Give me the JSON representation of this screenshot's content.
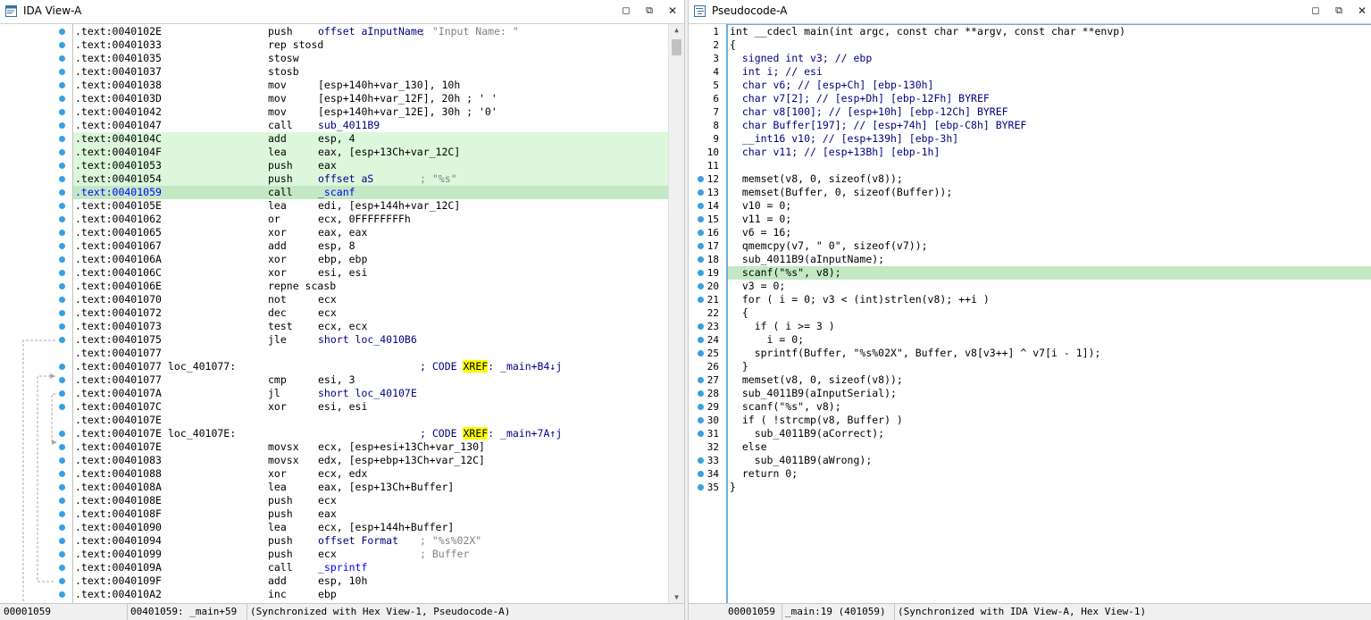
{
  "left": {
    "title": "IDA View-A",
    "status": {
      "offset": "00001059",
      "location": "00401059: _main+59",
      "sync": "(Synchronized with Hex View-1, Pseudocode-A)"
    },
    "lines": [
      {
        "addr": ".text:0040102E",
        "mn": "push",
        "op": "offset aInputName",
        "cm": "; \"Input Name: \""
      },
      {
        "addr": ".text:00401033",
        "mn": "rep stosd",
        "op": ""
      },
      {
        "addr": ".text:00401035",
        "mn": "stosw",
        "op": ""
      },
      {
        "addr": ".text:00401037",
        "mn": "stosb",
        "op": ""
      },
      {
        "addr": ".text:00401038",
        "mn": "mov",
        "op": "[esp+140h+var_130], 10h"
      },
      {
        "addr": ".text:0040103D",
        "mn": "mov",
        "op": "[esp+140h+var_12F], 20h ; ' '"
      },
      {
        "addr": ".text:00401042",
        "mn": "mov",
        "op": "[esp+140h+var_12E], 30h ; '0'"
      },
      {
        "addr": ".text:00401047",
        "mn": "call",
        "op": "sub_4011B9"
      },
      {
        "addr": ".text:0040104C",
        "mn": "add",
        "op": "esp, 4",
        "hl": true
      },
      {
        "addr": ".text:0040104F",
        "mn": "lea",
        "op": "eax, [esp+13Ch+var_12C]",
        "hl": true
      },
      {
        "addr": ".text:00401053",
        "mn": "push",
        "op": "eax",
        "hl": true
      },
      {
        "addr": ".text:00401054",
        "mn": "push",
        "op": "offset aS",
        "cm": "; \"%s\"",
        "hl": true
      },
      {
        "addr": ".text:00401059",
        "mn": "call",
        "op": "_scanf",
        "cur": true
      },
      {
        "addr": ".text:0040105E",
        "mn": "lea",
        "op": "edi, [esp+144h+var_12C]"
      },
      {
        "addr": ".text:00401062",
        "mn": "or",
        "op": "ecx, 0FFFFFFFFh"
      },
      {
        "addr": ".text:00401065",
        "mn": "xor",
        "op": "eax, eax"
      },
      {
        "addr": ".text:00401067",
        "mn": "add",
        "op": "esp, 8"
      },
      {
        "addr": ".text:0040106A",
        "mn": "xor",
        "op": "ebp, ebp"
      },
      {
        "addr": ".text:0040106C",
        "mn": "xor",
        "op": "esi, esi"
      },
      {
        "addr": ".text:0040106E",
        "mn": "repne scasb",
        "op": ""
      },
      {
        "addr": ".text:00401070",
        "mn": "not",
        "op": "ecx"
      },
      {
        "addr": ".text:00401072",
        "mn": "dec",
        "op": "ecx"
      },
      {
        "addr": ".text:00401073",
        "mn": "test",
        "op": "ecx, ecx"
      },
      {
        "addr": ".text:00401075",
        "mn": "jle",
        "op": "short loc_4010B6"
      },
      {
        "addr": ".text:00401077",
        "mn": "",
        "op": ""
      },
      {
        "addr": ".text:00401077",
        "lbl": "loc_401077:",
        "cm": "; CODE XREF: _main+B4↓j",
        "xref": true
      },
      {
        "addr": ".text:00401077",
        "mn": "cmp",
        "op": "esi, 3"
      },
      {
        "addr": ".text:0040107A",
        "mn": "jl",
        "op": "short loc_40107E"
      },
      {
        "addr": ".text:0040107C",
        "mn": "xor",
        "op": "esi, esi"
      },
      {
        "addr": ".text:0040107E",
        "mn": "",
        "op": ""
      },
      {
        "addr": ".text:0040107E",
        "lbl": "loc_40107E:",
        "cm": "; CODE XREF: _main+7A↑j",
        "xref": true
      },
      {
        "addr": ".text:0040107E",
        "mn": "movsx",
        "op": "ecx, [esp+esi+13Ch+var_130]"
      },
      {
        "addr": ".text:00401083",
        "mn": "movsx",
        "op": "edx, [esp+ebp+13Ch+var_12C]"
      },
      {
        "addr": ".text:00401088",
        "mn": "xor",
        "op": "ecx, edx"
      },
      {
        "addr": ".text:0040108A",
        "mn": "lea",
        "op": "eax, [esp+13Ch+Buffer]"
      },
      {
        "addr": ".text:0040108E",
        "mn": "push",
        "op": "ecx"
      },
      {
        "addr": ".text:0040108F",
        "mn": "push",
        "op": "eax"
      },
      {
        "addr": ".text:00401090",
        "mn": "lea",
        "op": "ecx, [esp+144h+Buffer]"
      },
      {
        "addr": ".text:00401094",
        "mn": "push",
        "op": "offset Format",
        "cm": "; \"%s%02X\""
      },
      {
        "addr": ".text:00401099",
        "mn": "push",
        "op": "ecx",
        "cm": "; Buffer"
      },
      {
        "addr": ".text:0040109A",
        "mn": "call",
        "op": "_sprintf"
      },
      {
        "addr": ".text:0040109F",
        "mn": "add",
        "op": "esp, 10h"
      },
      {
        "addr": ".text:004010A2",
        "mn": "inc",
        "op": "ebp"
      }
    ]
  },
  "right": {
    "title": "Pseudocode-A",
    "status": {
      "offset": "00001059",
      "location": "_main:19 (401059)",
      "sync": "(Synchronized with IDA View-A, Hex View-1)"
    },
    "lines": [
      {
        "n": "1",
        "code": "int __cdecl main(int argc, const char **argv, const char **envp)"
      },
      {
        "n": "2",
        "code": "{"
      },
      {
        "n": "3",
        "code": "  signed int v3; // ebp"
      },
      {
        "n": "4",
        "code": "  int i; // esi"
      },
      {
        "n": "5",
        "code": "  char v6; // [esp+Ch] [ebp-130h]"
      },
      {
        "n": "6",
        "code": "  char v7[2]; // [esp+Dh] [ebp-12Fh] BYREF"
      },
      {
        "n": "7",
        "code": "  char v8[100]; // [esp+10h] [ebp-12Ch] BYREF"
      },
      {
        "n": "8",
        "code": "  char Buffer[197]; // [esp+74h] [ebp-C8h] BYREF"
      },
      {
        "n": "9",
        "code": "  __int16 v10; // [esp+139h] [ebp-3h]"
      },
      {
        "n": "10",
        "code": "  char v11; // [esp+13Bh] [ebp-1h]"
      },
      {
        "n": "11",
        "code": ""
      },
      {
        "n": "12",
        "code": "  memset(v8, 0, sizeof(v8));",
        "dot": true
      },
      {
        "n": "13",
        "code": "  memset(Buffer, 0, sizeof(Buffer));",
        "dot": true
      },
      {
        "n": "14",
        "code": "  v10 = 0;",
        "dot": true
      },
      {
        "n": "15",
        "code": "  v11 = 0;",
        "dot": true
      },
      {
        "n": "16",
        "code": "  v6 = 16;",
        "dot": true
      },
      {
        "n": "17",
        "code": "  qmemcpy(v7, \" 0\", sizeof(v7));",
        "dot": true
      },
      {
        "n": "18",
        "code": "  sub_4011B9(aInputName);",
        "dot": true
      },
      {
        "n": "19",
        "code": "  scanf(\"%s\", v8);",
        "dot": true,
        "cur": true
      },
      {
        "n": "20",
        "code": "  v3 = 0;",
        "dot": true
      },
      {
        "n": "21",
        "code": "  for ( i = 0; v3 < (int)strlen(v8); ++i )",
        "dot": true
      },
      {
        "n": "22",
        "code": "  {"
      },
      {
        "n": "23",
        "code": "    if ( i >= 3 )",
        "dot": true
      },
      {
        "n": "24",
        "code": "      i = 0;",
        "dot": true
      },
      {
        "n": "25",
        "code": "    sprintf(Buffer, \"%s%02X\", Buffer, v8[v3++] ^ v7[i - 1]);",
        "dot": true
      },
      {
        "n": "26",
        "code": "  }"
      },
      {
        "n": "27",
        "code": "  memset(v8, 0, sizeof(v8));",
        "dot": true
      },
      {
        "n": "28",
        "code": "  sub_4011B9(aInputSerial);",
        "dot": true
      },
      {
        "n": "29",
        "code": "  scanf(\"%s\", v8);",
        "dot": true
      },
      {
        "n": "30",
        "code": "  if ( !strcmp(v8, Buffer) )",
        "dot": true
      },
      {
        "n": "31",
        "code": "    sub_4011B9(aCorrect);",
        "dot": true
      },
      {
        "n": "32",
        "code": "  else"
      },
      {
        "n": "33",
        "code": "    sub_4011B9(aWrong);",
        "dot": true
      },
      {
        "n": "34",
        "code": "  return 0;",
        "dot": true
      },
      {
        "n": "35",
        "code": "}",
        "dot": true
      }
    ]
  },
  "colors": {
    "highlight": "#dcf7dc",
    "current": "#c4e8c4",
    "dot": "#3aa0e0",
    "xref": "#ffff00"
  },
  "icons": [
    "ida-view-icon",
    "pseudocode-icon",
    "restore-icon",
    "float-icon",
    "close-icon"
  ]
}
